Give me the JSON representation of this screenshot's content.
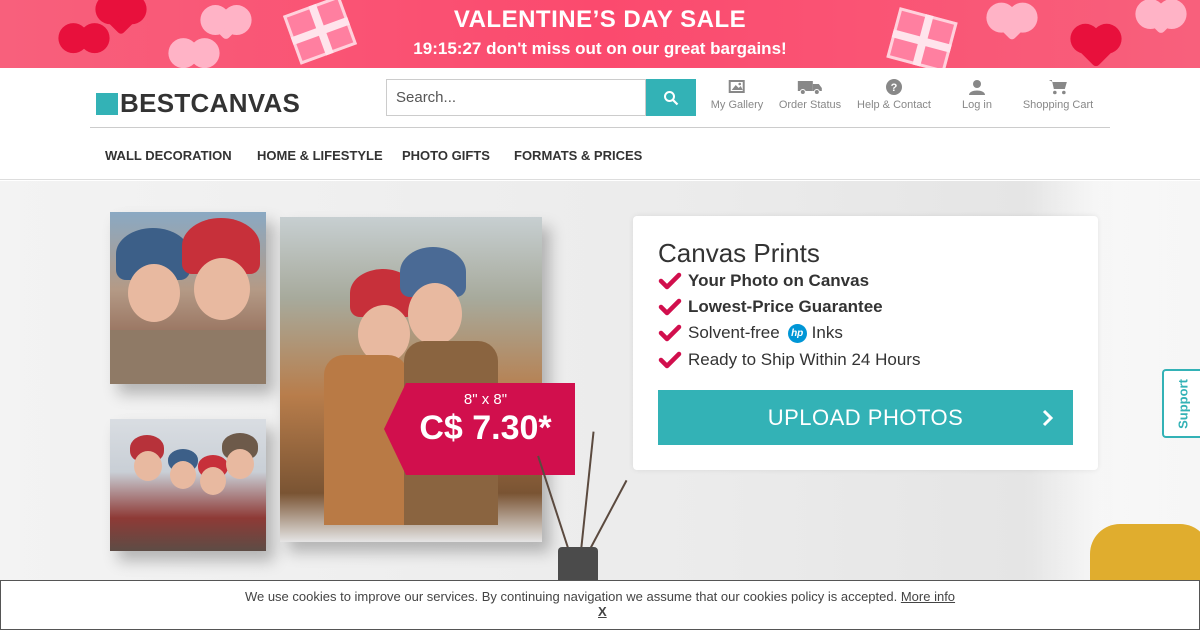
{
  "promo": {
    "title": "VALENTINE’S DAY SALE",
    "countdown_text": "19:15:27 don't miss out on our great bargains!"
  },
  "header": {
    "logo": "BESTCANVAS",
    "search_placeholder": "Search...",
    "nav": [
      {
        "label": "My Gallery",
        "icon": "gallery-icon"
      },
      {
        "label": "Order Status",
        "icon": "truck-icon"
      },
      {
        "label": "Help & Contact",
        "icon": "help-icon"
      },
      {
        "label": "Log in",
        "icon": "user-icon"
      },
      {
        "label": "Shopping Cart",
        "icon": "cart-icon"
      }
    ]
  },
  "menu": [
    "WALL DECORATION",
    "HOME & LIFESTYLE",
    "PHOTO GIFTS",
    "FORMATS & PRICES"
  ],
  "hero": {
    "price_size": "8\" x 8\"",
    "price_value": "C$ 7.30*"
  },
  "card": {
    "title": "Canvas Prints",
    "features": [
      {
        "text": "Your Photo on Canvas",
        "bold": true
      },
      {
        "text": "Lowest-Price Guarantee",
        "bold": true
      },
      {
        "text_before": "Solvent-free",
        "logo": "hp",
        "text_after": "Inks",
        "bold": false
      },
      {
        "text": "Ready to Ship Within 24 Hours",
        "bold": false
      }
    ],
    "upload_label": "UPLOAD PHOTOS"
  },
  "support_label": "Support",
  "cookie": {
    "text": "We use cookies to improve our services. By continuing navigation we assume that our cookies policy is accepted.",
    "link": "More info",
    "close": "X"
  },
  "colors": {
    "accent": "#33b2b6",
    "price_tag": "#d10f4d",
    "check": "#d10f4d",
    "promo": "#fb4a6e"
  }
}
